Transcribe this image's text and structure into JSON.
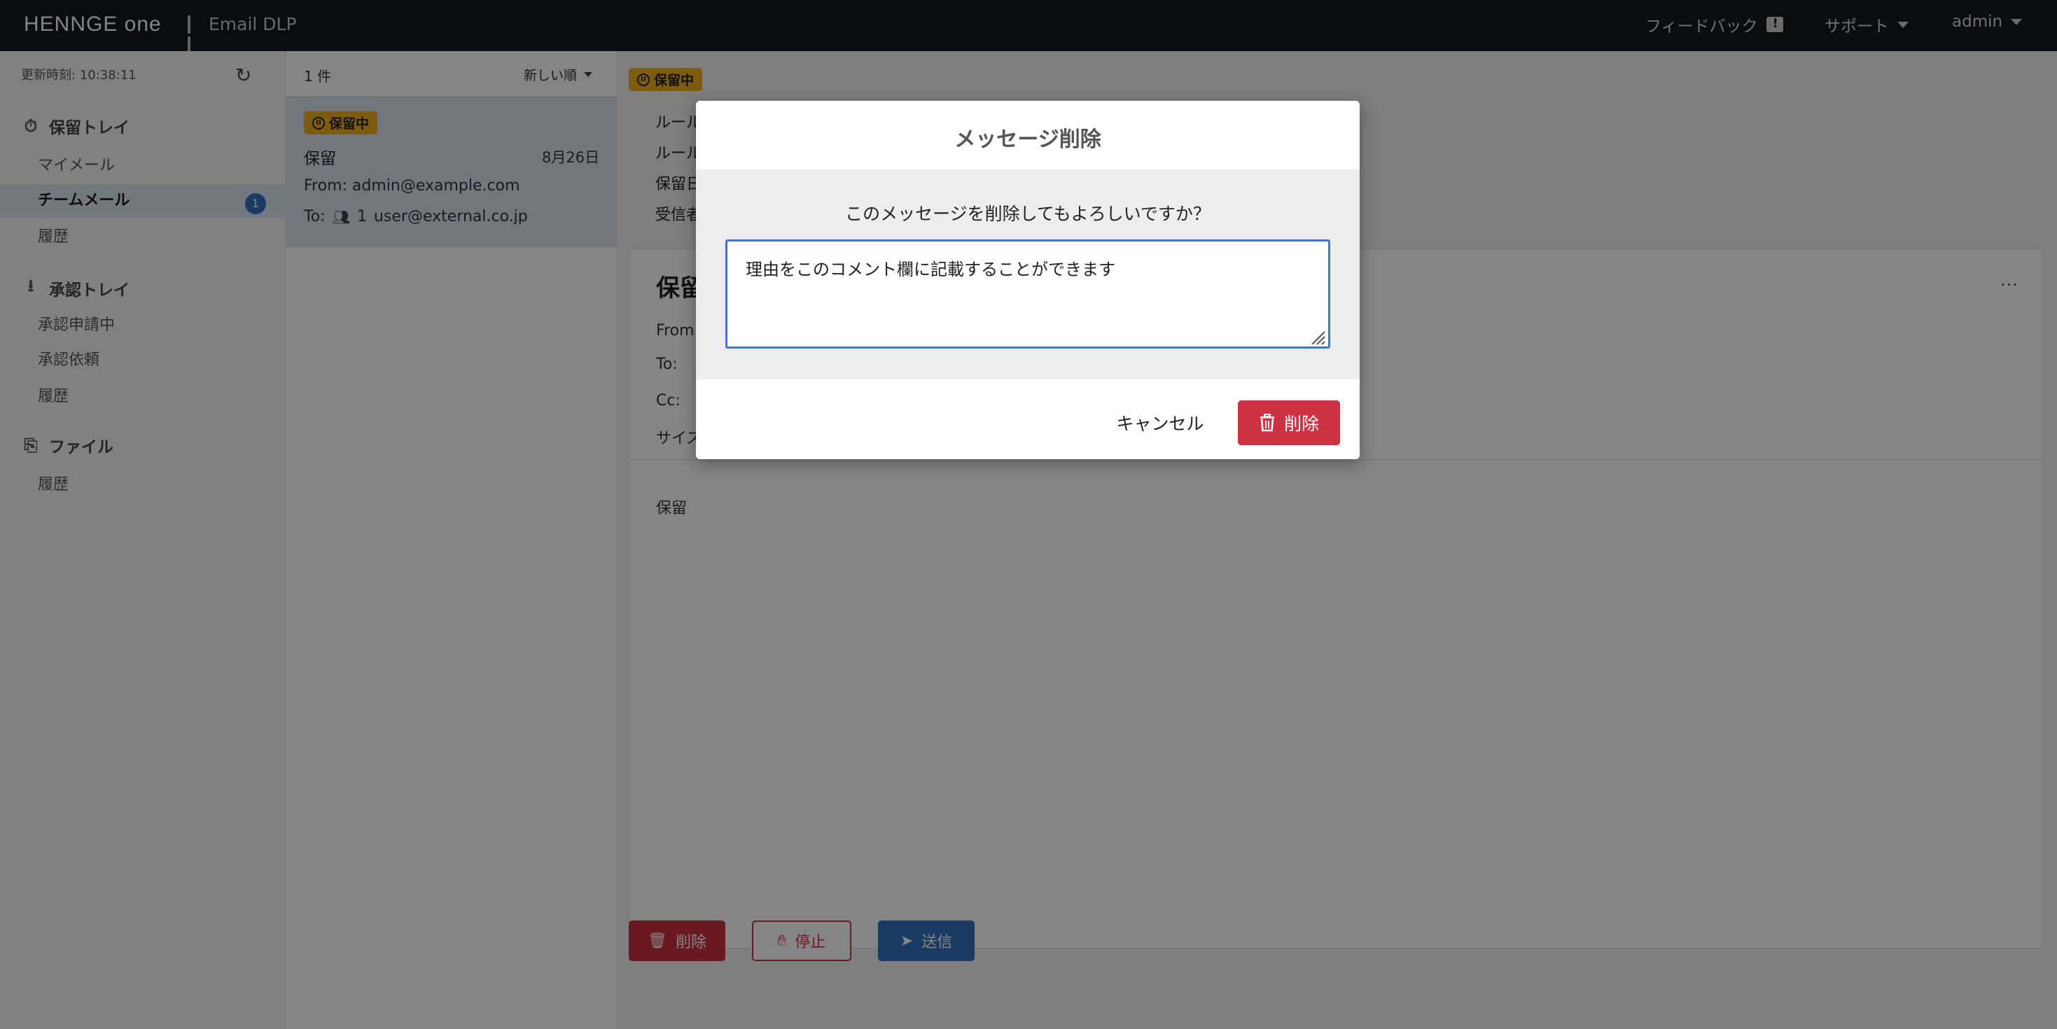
{
  "header": {
    "logo": "HENNGE one",
    "product": "Email DLP",
    "feedback": "フィードバック",
    "support": "サポート",
    "user": "admin"
  },
  "sidebar": {
    "updated": "更新時刻: 10:38:11",
    "hold_tray": {
      "title": "保留トレイ",
      "items": [
        {
          "label": "マイメール"
        },
        {
          "label": "チームメール",
          "count": "1"
        },
        {
          "label": "履歴"
        }
      ]
    },
    "approval_tray": {
      "title": "承認トレイ",
      "items": [
        {
          "label": "承認申請中"
        },
        {
          "label": "承認依頼"
        },
        {
          "label": "履歴"
        }
      ]
    },
    "files": {
      "title": "ファイル",
      "items": [
        {
          "label": "履歴"
        }
      ]
    }
  },
  "list": {
    "count": "1 件",
    "sort": "新しい順",
    "items": [
      {
        "status": "保留中",
        "subject": "保留",
        "date": "8月26日",
        "from": "From: admin@example.com",
        "to_label": "To:",
        "to_count": "1",
        "to_address": "user@external.co.jp"
      }
    ]
  },
  "detail": {
    "status": "保留中",
    "meta": [
      "ルール",
      "ルール",
      "保留日",
      "受信者"
    ],
    "title": "保留",
    "more": "...",
    "fields": [
      "From:",
      "To:",
      "Cc:",
      "サイズ"
    ],
    "body": "保留",
    "actions": {
      "delete": "削除",
      "stop": "停止",
      "send": "送信"
    }
  },
  "modal": {
    "title": "メッセージ削除",
    "question": "このメッセージを削除してもよろしいですか？",
    "comment_value": "理由をこのコメント欄に記載することができます",
    "cancel": "キャンセル",
    "delete": "削除"
  },
  "colors": {
    "topbar": "#16171c",
    "accent_blue": "#2f6fbf",
    "danger_red": "#cc3144",
    "hold_yellow": "#f2b01e",
    "active_item": "#dde7f3"
  }
}
